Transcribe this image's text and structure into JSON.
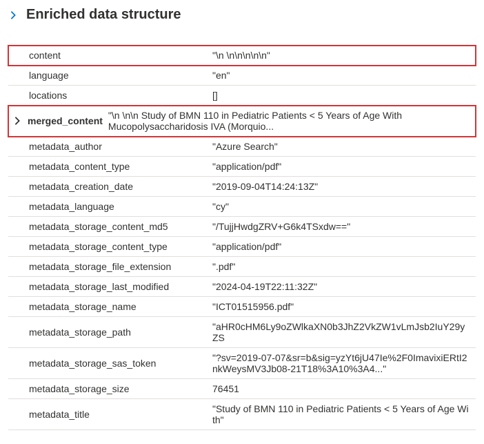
{
  "header": {
    "title": "Enriched data structure"
  },
  "rows": {
    "content": {
      "key": "content",
      "value": "\"\\n \\n\\n\\n\\n\\n\""
    },
    "language": {
      "key": "language",
      "value": "\"en\""
    },
    "locations": {
      "key": "locations",
      "value": "[]"
    },
    "merged_content": {
      "key": "merged_content",
      "value": "\"\\n \\n\\n Study of BMN 110 in Pediatric Patients < 5 Years of Age With Mucopolysaccharidosis IVA (Morquio..."
    },
    "metadata_author": {
      "key": "metadata_author",
      "value": "\"Azure Search\""
    },
    "metadata_content_type": {
      "key": "metadata_content_type",
      "value": "\"application/pdf\""
    },
    "metadata_creation_date": {
      "key": "metadata_creation_date",
      "value": "\"2019-09-04T14:24:13Z\""
    },
    "metadata_language": {
      "key": "metadata_language",
      "value": "\"cy\""
    },
    "metadata_storage_content_md5": {
      "key": "metadata_storage_content_md5",
      "value": "\"/TujjHwdgZRV+G6k4TSxdw==\""
    },
    "metadata_storage_content_type": {
      "key": "metadata_storage_content_type",
      "value": "\"application/pdf\""
    },
    "metadata_storage_file_extension": {
      "key": "metadata_storage_file_extension",
      "value": "\".pdf\""
    },
    "metadata_storage_last_modified": {
      "key": "metadata_storage_last_modified",
      "value": "\"2024-04-19T22:11:32Z\""
    },
    "metadata_storage_name": {
      "key": "metadata_storage_name",
      "value": "\"ICT01515956.pdf\""
    },
    "metadata_storage_path": {
      "key": "metadata_storage_path",
      "value": "\"aHR0cHM6Ly9oZWlkaXN0b3JhZ2VkZW1vLmJsb2IuY29yZS"
    },
    "metadata_storage_sas_token": {
      "key": "metadata_storage_sas_token",
      "value": "\"?sv=2019-07-07&sr=b&sig=yzYt6jU47Ie%2F0ImavixiERtI2nkWeysMV3Jb08-21T18%3A10%3A4...\""
    },
    "metadata_storage_size": {
      "key": "metadata_storage_size",
      "value": "76451"
    },
    "metadata_title": {
      "key": "metadata_title",
      "value": "\"Study of BMN 110 in Pediatric Patients < 5 Years of Age With\""
    }
  }
}
